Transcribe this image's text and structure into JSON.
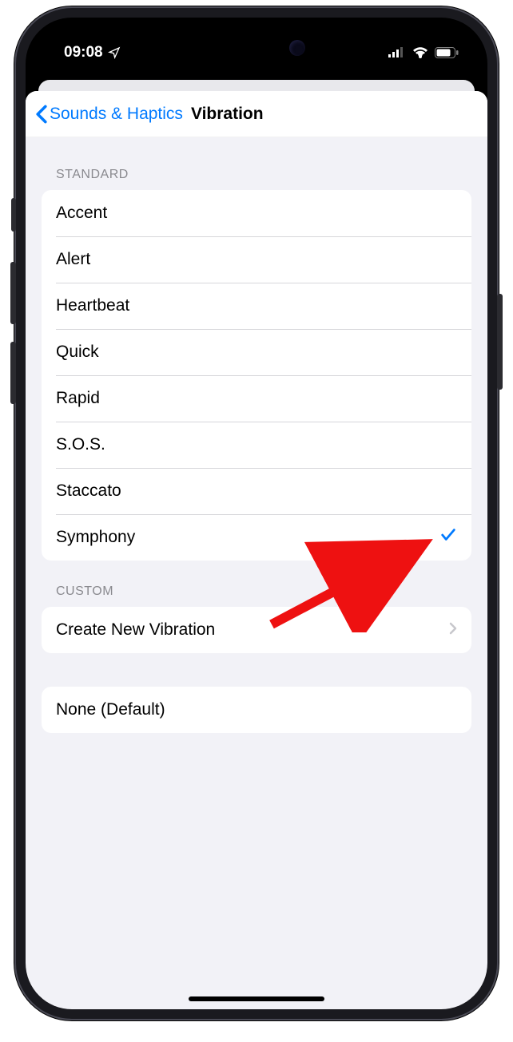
{
  "status": {
    "time": "09:08",
    "location_icon": "location-arrow",
    "cell_icon": "cellular-bars",
    "wifi_icon": "wifi",
    "battery_icon": "battery"
  },
  "nav": {
    "back_label": "Sounds & Haptics",
    "title": "Vibration"
  },
  "sections": {
    "standard": {
      "header": "STANDARD",
      "items": [
        {
          "label": "Accent",
          "selected": false
        },
        {
          "label": "Alert",
          "selected": false
        },
        {
          "label": "Heartbeat",
          "selected": false
        },
        {
          "label": "Quick",
          "selected": false
        },
        {
          "label": "Rapid",
          "selected": false
        },
        {
          "label": "S.O.S.",
          "selected": false
        },
        {
          "label": "Staccato",
          "selected": false
        },
        {
          "label": "Symphony",
          "selected": true
        }
      ]
    },
    "custom": {
      "header": "CUSTOM",
      "create_label": "Create New Vibration"
    },
    "none": {
      "label": "None (Default)"
    }
  }
}
